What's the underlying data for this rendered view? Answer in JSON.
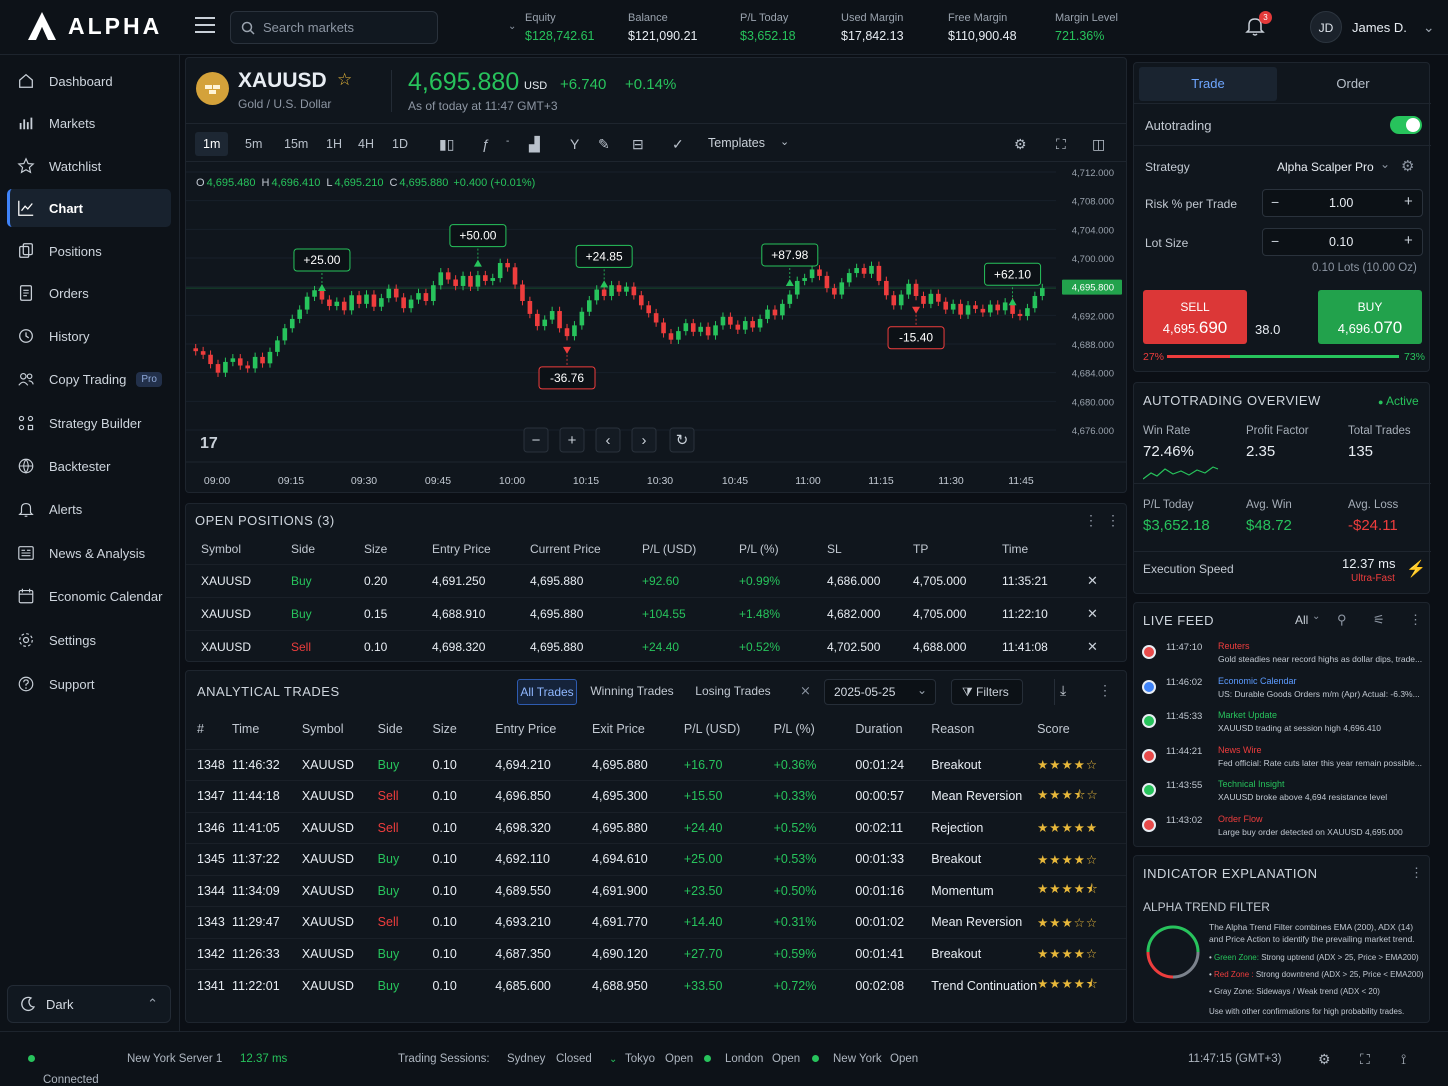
{
  "app": {
    "name": "ALPHA"
  },
  "search": {
    "placeholder": "Search markets"
  },
  "account": [
    {
      "label": "Equity",
      "value": "$128,742.61",
      "color": "green"
    },
    {
      "label": "Balance",
      "value": "$121,090.21",
      "color": "white"
    },
    {
      "label": "P/L Today",
      "value": "$3,652.18",
      "color": "green"
    },
    {
      "label": "Used Margin",
      "value": "$17,842.13",
      "color": "white"
    },
    {
      "label": "Free Margin",
      "value": "$110,900.48",
      "color": "white"
    },
    {
      "label": "Margin Level",
      "value": "721.36%",
      "color": "green"
    }
  ],
  "notifications": {
    "count": "3"
  },
  "user": {
    "initials": "JD",
    "name": "James D."
  },
  "sidebar": {
    "items": [
      {
        "label": "Dashboard",
        "icon": "home-icon"
      },
      {
        "label": "Markets",
        "icon": "bar-chart-icon"
      },
      {
        "label": "Watchlist",
        "icon": "star-icon"
      },
      {
        "label": "Chart",
        "icon": "line-chart-icon",
        "active": true
      },
      {
        "label": "Positions",
        "icon": "layers-icon"
      },
      {
        "label": "Orders",
        "icon": "document-icon"
      },
      {
        "label": "History",
        "icon": "history-icon"
      },
      {
        "label": "Copy Trading",
        "icon": "users-icon",
        "badge": "Pro"
      },
      {
        "label": "Strategy Builder",
        "icon": "grid-icon"
      },
      {
        "label": "Backtester",
        "icon": "globe-icon"
      },
      {
        "label": "Alerts",
        "icon": "bell-icon"
      },
      {
        "label": "News & Analysis",
        "icon": "news-icon"
      },
      {
        "label": "Economic Calendar",
        "icon": "calendar-icon"
      },
      {
        "label": "Settings",
        "icon": "gear-icon"
      },
      {
        "label": "Support",
        "icon": "help-icon"
      }
    ],
    "theme": "Dark"
  },
  "symbol": {
    "code": "XAUUSD",
    "name": "Gold / U.S. Dollar",
    "price": "4,695.880",
    "currency": "USD",
    "change": "+6.740",
    "change_pct": "+0.14%",
    "asof": "As of today at 11:47 GMT+3"
  },
  "toolbar": {
    "timeframes": [
      "1m",
      "5m",
      "15m",
      "1H",
      "4H",
      "1D"
    ],
    "active": "1m",
    "templates": "Templates"
  },
  "ohlc": {
    "o_label": "O",
    "o": "4,695.480",
    "h_label": "H",
    "h": "4,696.410",
    "l_label": "L",
    "l": "4,695.210",
    "c_label": "C",
    "c": "4,695.880",
    "chg": "+0.400 (+0.01%)"
  },
  "chart_data": {
    "type": "candlestick",
    "x_ticks": [
      "09:00",
      "09:15",
      "09:30",
      "09:45",
      "10:00",
      "10:15",
      "10:30",
      "10:45",
      "11:00",
      "11:15",
      "11:30",
      "11:45"
    ],
    "y_ticks": [
      "4,712.000",
      "4,708.000",
      "4,704.000",
      "4,700.000",
      "4,695.800",
      "4,692.000",
      "4,688.000",
      "4,684.000",
      "4,680.000",
      "4,676.000"
    ],
    "current_price": "4,695.800",
    "closes": [
      4687.0,
      4686.5,
      4685.2,
      4684.0,
      4685.5,
      4686.0,
      4685.0,
      4684.6,
      4686.2,
      4685.3,
      4686.9,
      4688.5,
      4690.2,
      4691.5,
      4692.8,
      4694.6,
      4695.5,
      4694.2,
      4693.3,
      4693.9,
      4692.7,
      4694.8,
      4693.6,
      4694.9,
      4693.2,
      4694.4,
      4695.7,
      4694.5,
      4693.0,
      4694.2,
      4695.1,
      4694.0,
      4696.2,
      4698.0,
      4697.0,
      4696.1,
      4697.5,
      4696.0,
      4697.6,
      4696.8,
      4697.2,
      4699.3,
      4698.7,
      4696.3,
      4694.0,
      4692.2,
      4690.5,
      4691.4,
      4692.6,
      4690.2,
      4689.1,
      4690.6,
      4692.5,
      4694.1,
      4695.6,
      4694.7,
      4696.2,
      4695.3,
      4696.0,
      4694.8,
      4693.4,
      4692.3,
      4691.0,
      4689.5,
      4688.6,
      4689.8,
      4690.9,
      4689.7,
      4690.4,
      4689.2,
      4690.6,
      4691.8,
      4690.7,
      4690.0,
      4691.2,
      4690.3,
      4691.5,
      4692.8,
      4692.0,
      4693.6,
      4694.9,
      4696.8,
      4697.2,
      4698.4,
      4697.5,
      4695.8,
      4694.9,
      4696.6,
      4697.9,
      4698.6,
      4697.8,
      4698.9,
      4696.8,
      4694.8,
      4693.4,
      4694.9,
      4696.4,
      4694.7,
      4693.6,
      4695.0,
      4693.9,
      4692.8,
      4693.6,
      4692.1,
      4693.4,
      4692.9,
      4692.4,
      4693.5,
      4692.7,
      4693.8,
      4692.2,
      4691.9,
      4693.0,
      4694.7,
      4695.8
    ],
    "annotations": [
      {
        "label": "+25.00",
        "type": "win"
      },
      {
        "label": "+50.00",
        "type": "win"
      },
      {
        "label": "+24.85",
        "type": "win"
      },
      {
        "label": "-36.76",
        "type": "loss"
      },
      {
        "label": "+87.98",
        "type": "win"
      },
      {
        "label": "-15.40",
        "type": "loss"
      },
      {
        "label": "+62.10",
        "type": "win"
      }
    ]
  },
  "positions": {
    "title": "OPEN POSITIONS (3)",
    "headers": [
      "Symbol",
      "Side",
      "Size",
      "Entry Price",
      "Current Price",
      "P/L (USD)",
      "P/L (%)",
      "SL",
      "TP",
      "Time"
    ],
    "rows": [
      [
        "XAUUSD",
        "Buy",
        "0.20",
        "4,691.250",
        "4,695.880",
        "+92.60",
        "+0.99%",
        "4,686.000",
        "4,705.000",
        "11:35:21"
      ],
      [
        "XAUUSD",
        "Buy",
        "0.15",
        "4,688.910",
        "4,695.880",
        "+104.55",
        "+1.48%",
        "4,682.000",
        "4,705.000",
        "11:22:10"
      ],
      [
        "XAUUSD",
        "Sell",
        "0.10",
        "4,698.320",
        "4,695.880",
        "+24.40",
        "+0.52%",
        "4,702.500",
        "4,688.000",
        "11:41:08"
      ]
    ]
  },
  "trades": {
    "title": "ANALYTICAL TRADES",
    "tabs": [
      "All Trades",
      "Winning Trades",
      "Losing Trades"
    ],
    "date": "2025-05-25",
    "filters": "Filters",
    "headers": [
      "#",
      "Time",
      "Symbol",
      "Side",
      "Size",
      "Entry Price",
      "Exit Price",
      "P/L (USD)",
      "P/L (%)",
      "Duration",
      "Reason",
      "Score"
    ],
    "rows": [
      [
        "1348",
        "11:46:32",
        "XAUUSD",
        "Buy",
        "0.10",
        "4,694.210",
        "4,695.880",
        "+16.70",
        "+0.36%",
        "00:01:24",
        "Breakout",
        4
      ],
      [
        "1347",
        "11:44:18",
        "XAUUSD",
        "Sell",
        "0.10",
        "4,696.850",
        "4,695.300",
        "+15.50",
        "+0.33%",
        "00:00:57",
        "Mean Reversion",
        3.5
      ],
      [
        "1346",
        "11:41:05",
        "XAUUSD",
        "Sell",
        "0.10",
        "4,698.320",
        "4,695.880",
        "+24.40",
        "+0.52%",
        "00:02:11",
        "Rejection",
        5
      ],
      [
        "1345",
        "11:37:22",
        "XAUUSD",
        "Buy",
        "0.10",
        "4,692.110",
        "4,694.610",
        "+25.00",
        "+0.53%",
        "00:01:33",
        "Breakout",
        4
      ],
      [
        "1344",
        "11:34:09",
        "XAUUSD",
        "Buy",
        "0.10",
        "4,689.550",
        "4,691.900",
        "+23.50",
        "+0.50%",
        "00:01:16",
        "Momentum",
        4.5
      ],
      [
        "1343",
        "11:29:47",
        "XAUUSD",
        "Sell",
        "0.10",
        "4,693.210",
        "4,691.770",
        "+14.40",
        "+0.31%",
        "00:01:02",
        "Mean Reversion",
        3
      ],
      [
        "1342",
        "11:26:33",
        "XAUUSD",
        "Buy",
        "0.10",
        "4,687.350",
        "4,690.120",
        "+27.70",
        "+0.59%",
        "00:01:41",
        "Breakout",
        4
      ],
      [
        "1341",
        "11:22:01",
        "XAUUSD",
        "Buy",
        "0.10",
        "4,685.600",
        "4,688.950",
        "+33.50",
        "+0.72%",
        "00:02:08",
        "Trend Continuation",
        4.5
      ]
    ]
  },
  "trade_panel": {
    "tabs": [
      "Trade",
      "Order"
    ],
    "autotrading_label": "Autotrading",
    "autotrading_on": true,
    "strategy_label": "Strategy",
    "strategy": "Alpha Scalper Pro",
    "risk_label": "Risk % per Trade",
    "risk": "1.00",
    "lot_label": "Lot Size",
    "lot": "0.10",
    "lot_note": "0.10 Lots (10.00 Oz)",
    "sell_label": "SELL",
    "sell_price_a": "4,695.",
    "sell_price_b": "690",
    "spread": "38.0",
    "buy_label": "BUY",
    "buy_price_a": "4,696.",
    "buy_price_b": "070",
    "sell_pct": "27%",
    "buy_pct": "73%",
    "sentiment_sell": 0.27
  },
  "overview": {
    "title": "AUTOTRADING OVERVIEW",
    "status": "Active",
    "stats": [
      {
        "label": "Win Rate",
        "value": "72.46%"
      },
      {
        "label": "Profit Factor",
        "value": "2.35"
      },
      {
        "label": "Total Trades",
        "value": "135"
      },
      {
        "label": "P/L Today",
        "value": "$3,652.18"
      },
      {
        "label": "Avg. Win",
        "value": "$48.72"
      },
      {
        "label": "Avg. Loss",
        "value": "-$24.11"
      }
    ],
    "exec_label": "Execution Speed",
    "exec_value": "12.37 ms",
    "exec_note": "Ultra-Fast"
  },
  "feed": {
    "title": "LIVE FEED",
    "filter": "All",
    "items": [
      {
        "time": "11:47:10",
        "source": "Reuters",
        "text": "Gold steadies near record highs as dollar dips, trade...",
        "color": "#e84a4a"
      },
      {
        "time": "11:46:02",
        "source": "Economic Calendar",
        "text": "US: Durable Goods Orders m/m (Apr)  Actual: -6.3%...",
        "color": "#3f83f8"
      },
      {
        "time": "11:45:33",
        "source": "Market Update",
        "text": "XAUUSD trading at session high 4,696.410",
        "color": "#27c35c"
      },
      {
        "time": "11:44:21",
        "source": "News Wire",
        "text": "Fed official: Rate cuts later this year remain possible...",
        "color": "#e84a4a"
      },
      {
        "time": "11:43:55",
        "source": "Technical Insight",
        "text": "XAUUSD broke above 4,694 resistance level",
        "color": "#27c35c"
      },
      {
        "time": "11:43:02",
        "source": "Order Flow",
        "text": "Large buy order detected on XAUUSD 4,695.000",
        "color": "#e84a4a"
      }
    ]
  },
  "indicator": {
    "title": "INDICATOR EXPLANATION",
    "name": "ALPHA TREND FILTER",
    "desc": "The Alpha Trend Filter combines EMA (200), ADX (14) and Price Action to identify the prevailing market trend.",
    "green_label": "Green Zone:",
    "green": "Strong uptrend (ADX > 25, Price > EMA200)",
    "red_label": "Red Zone :",
    "red": "Strong downtrend (ADX > 25, Price < EMA200)",
    "gray": "Gray Zone: Sideways / Weak trend (ADX < 20)",
    "note": "Use with other confirmations for high probability trades."
  },
  "status": {
    "connected": "Connected",
    "server": "New York Server 1",
    "latency": "12.37 ms",
    "sessions_label": "Trading Sessions:",
    "sessions": [
      {
        "name": "Sydney",
        "state": "Closed"
      },
      {
        "name": "Tokyo",
        "state": "Open"
      },
      {
        "name": "London",
        "state": "Open"
      },
      {
        "name": "New York",
        "state": "Open"
      }
    ],
    "clock": "11:47:15 (GMT+3)"
  }
}
